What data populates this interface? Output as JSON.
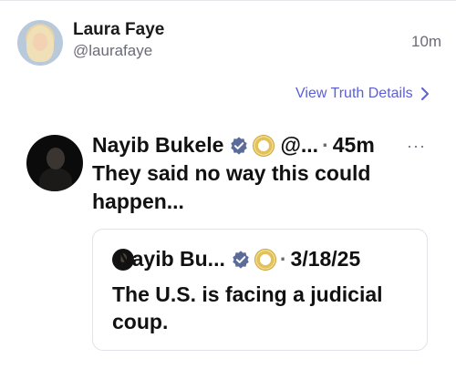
{
  "post": {
    "author_name": "Laura Faye",
    "author_handle": "@laurafaye",
    "time": "10m",
    "details_link": "View Truth Details",
    "details_icon": "chevron-right-icon"
  },
  "retruth": {
    "author_name": "Nayib Bukele",
    "author_handle": "@...",
    "separator": "·",
    "time": "45m",
    "more_label": "···",
    "text": "They said no way this could happen...",
    "verified_icon": "verified-badge-icon",
    "seal_icon": "el-salvador-seal-icon"
  },
  "quoted": {
    "author_name": "Nayib Bu...",
    "separator": "·",
    "date": "3/18/25",
    "text": "The U.S. is facing a judicial coup."
  },
  "colors": {
    "link": "#5b5fd8",
    "muted": "#6b6b78",
    "verified": "#5b6b9a",
    "border": "#e2e2e8"
  }
}
